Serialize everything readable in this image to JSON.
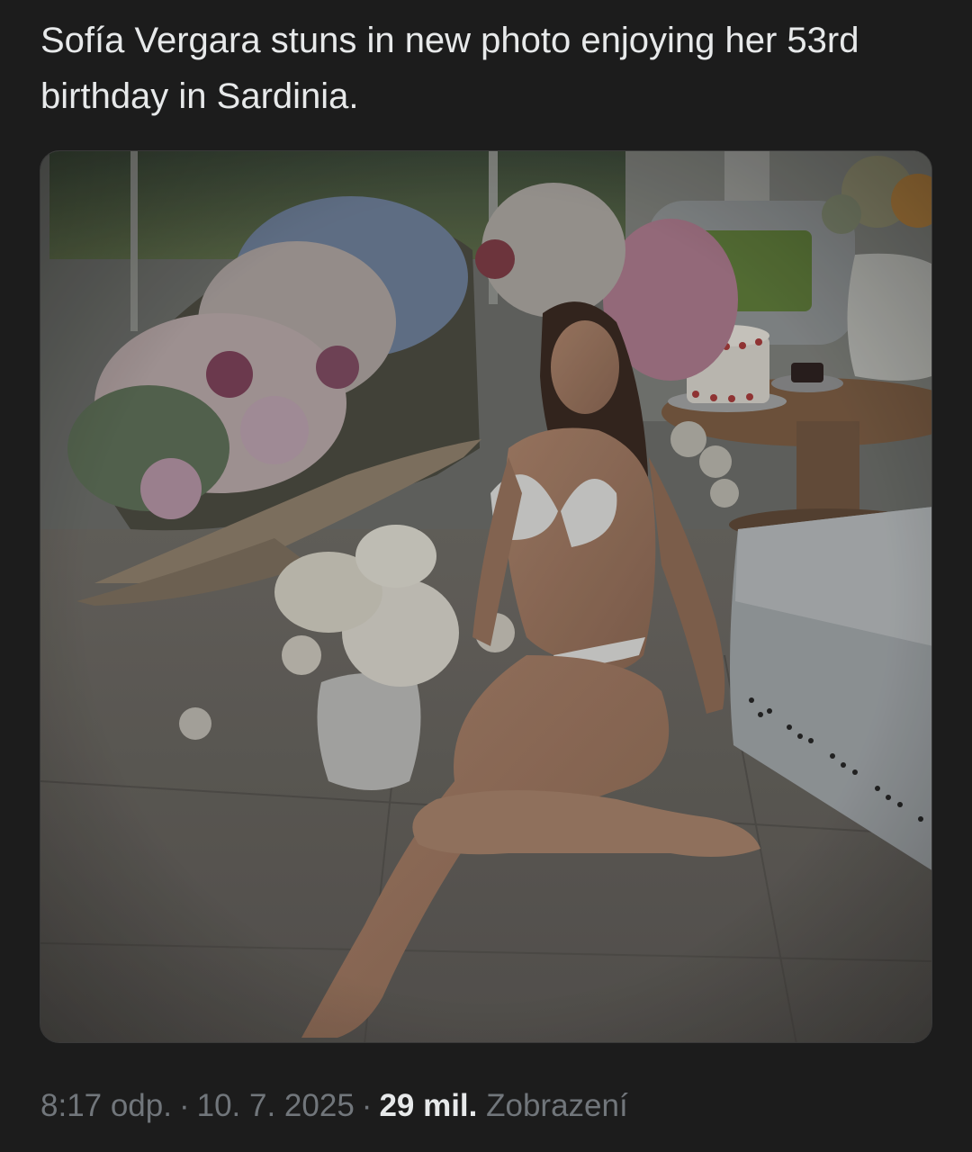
{
  "tweet": {
    "text": "Sofía Vergara stuns in new photo enjoying her 53rd birthday in Sardinia."
  },
  "media": {
    "alt": "Woman in a white bikini sitting on the floor beside large flower bouquets, a white vase with flowers, and a birthday cake on a round table"
  },
  "meta": {
    "time": "8:17 odp.",
    "separator": "·",
    "date": "10. 7. 2025",
    "views_count": "29 mil.",
    "views_label": "Zobrazení"
  }
}
